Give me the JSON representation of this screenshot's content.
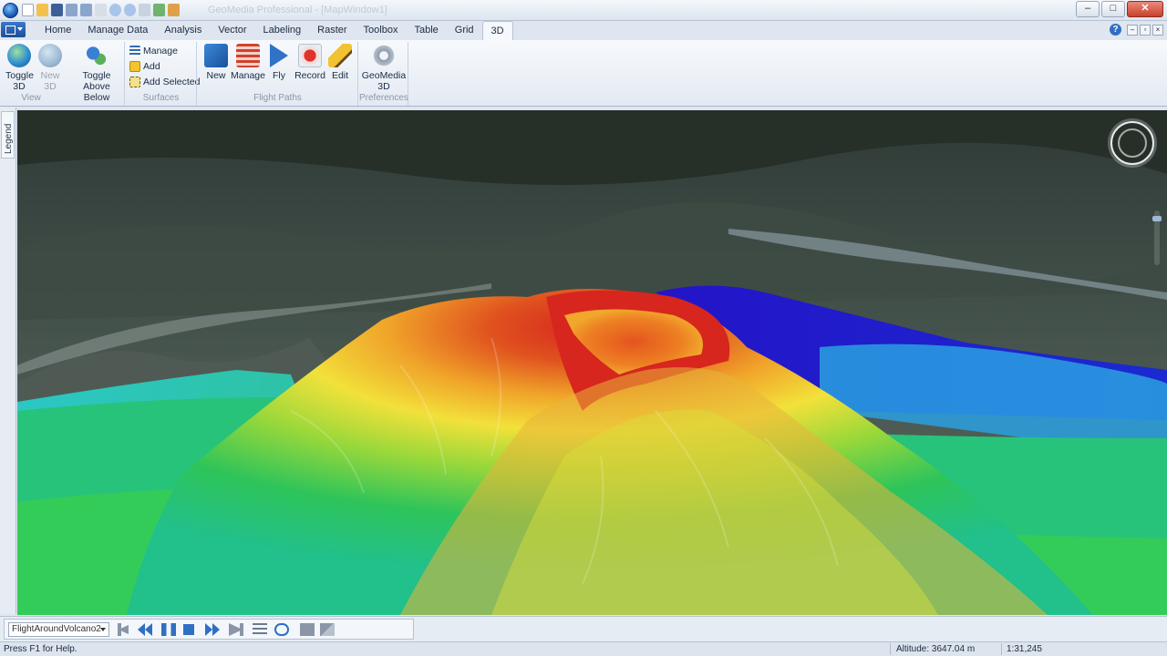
{
  "window": {
    "title": "GeoMedia Professional - [MapWindow1]",
    "minimize_glyph": "–",
    "maximize_glyph": "□",
    "close_glyph": "✕"
  },
  "ribbon": {
    "tabs": [
      "Home",
      "Manage Data",
      "Analysis",
      "Vector",
      "Labeling",
      "Raster",
      "Toolbox",
      "Table",
      "Grid",
      "3D"
    ],
    "active_tab": "3D",
    "help_glyph": "?",
    "groups": {
      "view": {
        "label": "View",
        "toggle3d": "Toggle\n3D",
        "new3d": "New\n3D"
      },
      "surfaces": {
        "label": "Surfaces",
        "toggle_above_below": "Toggle\nAbove Below",
        "manage": "Manage",
        "add": "Add",
        "add_selected": "Add Selected"
      },
      "flight_paths": {
        "label": "Flight Paths",
        "new": "New",
        "manage": "Manage",
        "fly": "Fly",
        "record": "Record",
        "edit": "Edit"
      },
      "preferences": {
        "label": "Preferences",
        "geomedia3d": "GeoMedia\n3D"
      }
    }
  },
  "legend_tab": "Legend",
  "flight_toolbar": {
    "selected_flight_path": "FlightAroundVolcano2"
  },
  "status": {
    "help": "Press F1 for Help.",
    "altitude": "Altitude: 3647.04 m",
    "scale": "1:31,245"
  },
  "colors": {
    "accent": "#2f6fc4",
    "elevation_high": "#d7261e",
    "elevation_mid": "#f2e13a",
    "elevation_low": "#2ec45a",
    "elevation_lowest": "#2414c8"
  }
}
